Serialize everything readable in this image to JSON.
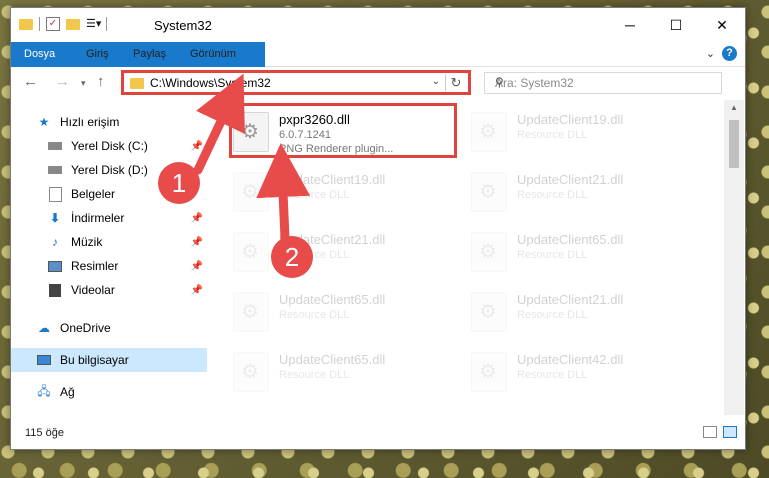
{
  "window": {
    "title": "System32",
    "controls": {
      "minimize": "─",
      "maximize": "☐",
      "close": "✕"
    }
  },
  "ribbon": {
    "tabs": [
      "Dosya",
      "Giriş",
      "Paylaş",
      "Görünüm"
    ],
    "help": "?"
  },
  "address": {
    "path": "C:\\Windows\\System32",
    "search_placeholder": "Ara: System32"
  },
  "sidebar": {
    "items": [
      {
        "label": "Hızlı erişim",
        "icon": "star-icon"
      },
      {
        "label": "Yerel Disk (C:)",
        "icon": "drive-icon",
        "pinned": true
      },
      {
        "label": "Yerel Disk (D:)",
        "icon": "drive-icon"
      },
      {
        "label": "Belgeler",
        "icon": "documents-icon"
      },
      {
        "label": "İndirmeler",
        "icon": "download-icon",
        "pinned": true
      },
      {
        "label": "Müzik",
        "icon": "music-icon",
        "pinned": true
      },
      {
        "label": "Resimler",
        "icon": "pictures-icon",
        "pinned": true
      },
      {
        "label": "Videolar",
        "icon": "videos-icon",
        "pinned": true
      },
      {
        "label": "OneDrive",
        "icon": "cloud-icon"
      },
      {
        "label": "Bu bilgisayar",
        "icon": "computer-icon",
        "selected": true
      },
      {
        "label": "Ağ",
        "icon": "network-icon"
      }
    ]
  },
  "files": {
    "highlighted": {
      "name": "pxpr3260.dll",
      "version": "6.0.7.1241",
      "description": "PNG Renderer plugin..."
    },
    "background": [
      {
        "name": "UpdateClient19.dll",
        "type": "Resource DLL"
      },
      {
        "name": "UpdateClient19.dll",
        "type": "Resource DLL"
      },
      {
        "name": "UpdateClient21.dll",
        "type": "Resource DLL"
      },
      {
        "name": "UpdateClient21.dll",
        "type": "Resource DLL"
      },
      {
        "name": "UpdateClient65.dll",
        "type": "Resource DLL"
      },
      {
        "name": "UpdateClient65.dll",
        "type": "Resource DLL"
      },
      {
        "name": "UpdateClient21.dll",
        "type": "Resource DLL"
      },
      {
        "name": "UpdateClient65.dll",
        "type": "Resource DLL"
      },
      {
        "name": "UpdateClient42.dll",
        "type": "Resource DLL"
      }
    ]
  },
  "status": {
    "count": "115 öğe"
  },
  "markers": [
    "1",
    "2"
  ],
  "colors": {
    "accent": "#1979ca",
    "highlight": "#e0443f",
    "selected": "#cce8ff"
  }
}
